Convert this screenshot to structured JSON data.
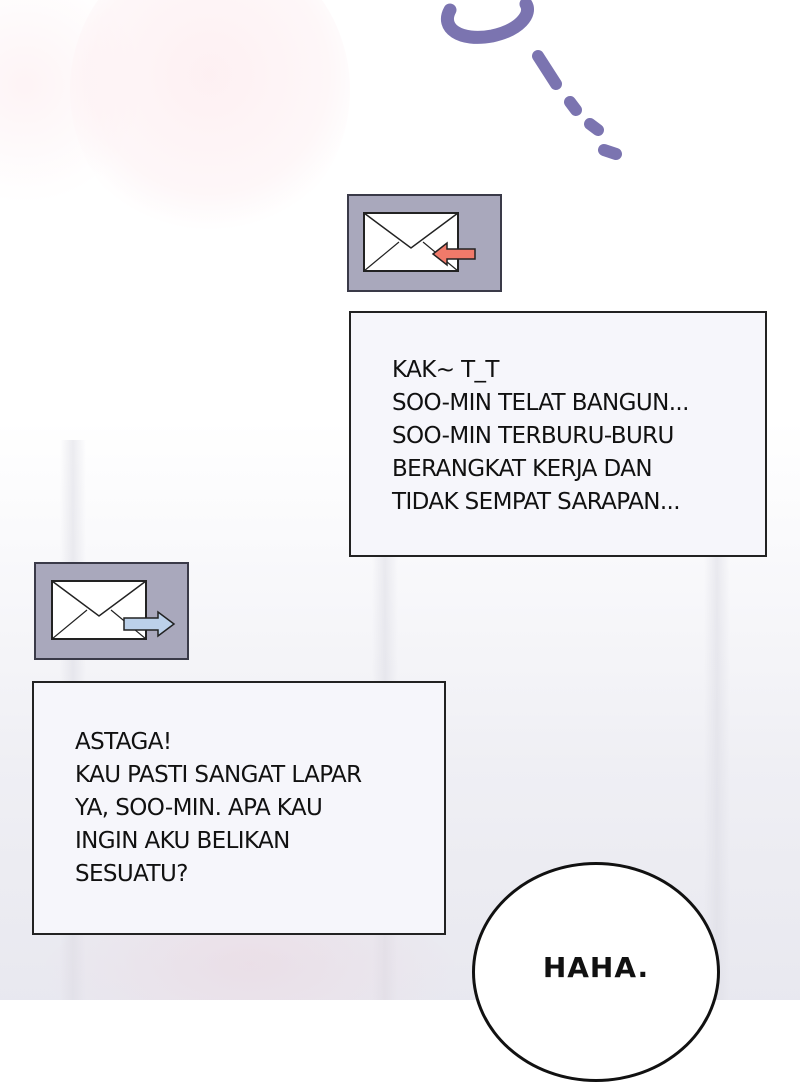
{
  "incoming_message": {
    "icon": "envelope-incoming-icon",
    "arrow_color": "#f07a6a",
    "lines": [
      "KAK~ T_T",
      "SOO-MIN TELAT BANGUN...",
      "SOO-MIN TERBURU-BURU",
      "BERANGKAT KERJA DAN",
      "TIDAK SEMPAT SARAPAN..."
    ]
  },
  "outgoing_message": {
    "icon": "envelope-outgoing-icon",
    "arrow_color": "#bcd1ea",
    "lines": [
      "ASTAGA!",
      "KAU PASTI SANGAT LAPAR",
      "YA, SOO-MIN. APA KAU",
      "INGIN AKU BELIKAN",
      "SESUATU?"
    ]
  },
  "speech_bubble": {
    "text": "HAHA."
  },
  "colors": {
    "icon_box_bg": "#a9a8bc",
    "squiggle": "#7b74b0",
    "message_box_bg": "#f6f6fb"
  }
}
